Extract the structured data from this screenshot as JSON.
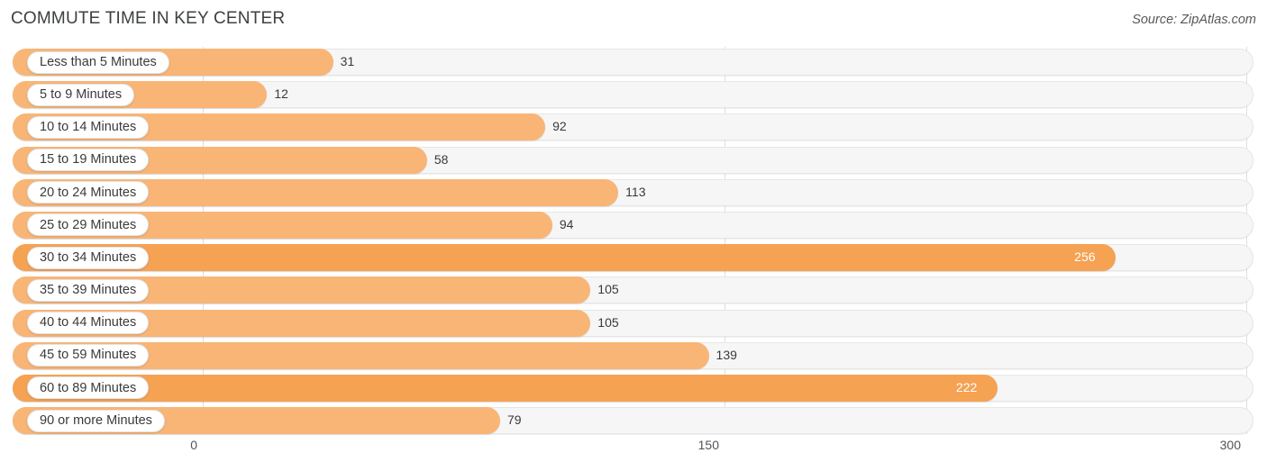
{
  "header": {
    "title": "COMMUTE TIME IN KEY CENTER",
    "source": "Source: ZipAtlas.com"
  },
  "colors": {
    "bar_light": "#f8b576",
    "bar_dark": "#f5a253",
    "track": "#f6f6f6",
    "gridline": "#dedede",
    "text": "#3a3a3a"
  },
  "chart_data": {
    "type": "bar",
    "orientation": "horizontal",
    "title": "COMMUTE TIME IN KEY CENTER",
    "xlabel": "",
    "ylabel": "",
    "xlim": [
      0,
      300
    ],
    "xticks": [
      0,
      150,
      300
    ],
    "xtick_labels": [
      "0",
      "150",
      "300"
    ],
    "grid": true,
    "legend": null,
    "categories": [
      "Less than 5 Minutes",
      "5 to 9 Minutes",
      "10 to 14 Minutes",
      "15 to 19 Minutes",
      "20 to 24 Minutes",
      "25 to 29 Minutes",
      "30 to 34 Minutes",
      "35 to 39 Minutes",
      "40 to 44 Minutes",
      "45 to 59 Minutes",
      "60 to 89 Minutes",
      "90 or more Minutes"
    ],
    "values": [
      31,
      12,
      92,
      58,
      113,
      94,
      256,
      105,
      105,
      139,
      222,
      79
    ],
    "value_labels": [
      "31",
      "12",
      "92",
      "58",
      "113",
      "94",
      "256",
      "105",
      "105",
      "139",
      "222",
      "79"
    ],
    "label_inside": [
      false,
      false,
      false,
      false,
      false,
      false,
      true,
      false,
      false,
      false,
      true,
      false
    ]
  }
}
